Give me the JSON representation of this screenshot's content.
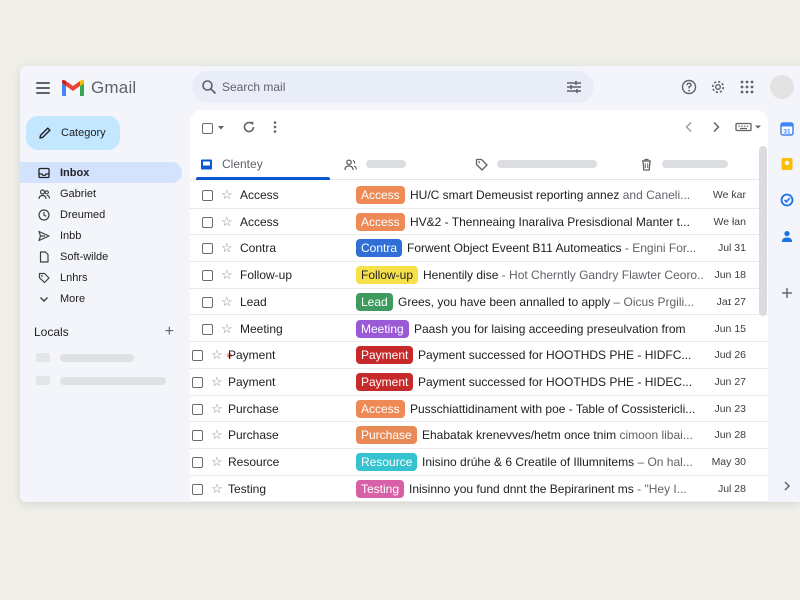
{
  "app": {
    "name": "Gmail"
  },
  "search": {
    "placeholder": "Search mail"
  },
  "compose": {
    "label": "Category"
  },
  "sidebar": {
    "items": [
      {
        "label": "Inbox",
        "icon": "inbox-icon",
        "active": true
      },
      {
        "label": "Gabriet",
        "icon": "people-icon"
      },
      {
        "label": "Dreumed",
        "icon": "clock-icon"
      },
      {
        "label": "Inbb",
        "icon": "send-icon"
      },
      {
        "label": "Soft-wilde",
        "icon": "file-icon"
      },
      {
        "label": "Lnhrs",
        "icon": "label-icon"
      },
      {
        "label": "More",
        "icon": "chevron-down-icon"
      }
    ],
    "locals_title": "Locals"
  },
  "tabs": [
    {
      "label": "Clentey",
      "icon": "inbox-icon",
      "active": true
    },
    {
      "label": "",
      "icon": "people-icon"
    },
    {
      "label": "",
      "icon": "tag-icon"
    },
    {
      "label": "",
      "icon": "trash-icon"
    }
  ],
  "colors": {
    "accent": "#0b57d0",
    "compose": "#c2e7ff",
    "active_nav": "#d3e3fd"
  },
  "emails": [
    {
      "sender": "Access",
      "label": "Access",
      "label_bg": "#ee8a55",
      "label_fg": "#ffffff",
      "subject": "HU/C smart Demeusist reporting annez",
      "snippet": " and Caneli...",
      "date": "We ƙar"
    },
    {
      "sender": "Access",
      "label": "Access",
      "label_bg": "#ee8a55",
      "label_fg": "#ffffff",
      "subject": "HV&2 - Thenneaing Inaraliva Presisdional Manter t...",
      "snippet": "",
      "date": "We ƚan"
    },
    {
      "sender": "Contra",
      "label": "Contra",
      "label_bg": "#2f6fd6",
      "label_fg": "#ffffff",
      "subject": "Forwent Object Eveent B11 Automeatics",
      "snippet": " - Engini For...",
      "date": "Jul 31"
    },
    {
      "sender": "Follow-up",
      "label": "Follow-up",
      "label_bg": "#f6e14a",
      "label_fg": "#202124",
      "subject": "Henentily dise",
      "snippet": " - Hot Cherntly Gandry Flawter Ceoro...",
      "date": "Jun 18"
    },
    {
      "sender": "Lead",
      "label": "Lead",
      "label_bg": "#3f9a5f",
      "label_fg": "#ffffff",
      "subject": "Grees, you have been annalled to apply",
      "snippet": " – Oicus Prgili...",
      "date": "Jaɪ 27"
    },
    {
      "sender": "Meeting",
      "label": "Meeting",
      "label_bg": "#9a5ad8",
      "label_fg": "#ffffff",
      "subject": "Paash you for laising acceeding preseulvation from",
      "snippet": "",
      "date": "Jun 15"
    },
    {
      "sender": "Payment",
      "label": "Payment",
      "label_bg": "#c62a2a",
      "label_fg": "#ffffff",
      "subject": "Payment successed for HOOTHDS PHE - HIDFC...",
      "snippet": "",
      "date": "Jud 26",
      "dot": true
    },
    {
      "sender": "Payment",
      "label": "Payment",
      "label_bg": "#c62a2a",
      "label_fg": "#ffffff",
      "subject": "Payment successed for HOOTHDS PHE - HIDEC...",
      "snippet": "",
      "date": "Jun 27"
    },
    {
      "sender": "Purchase",
      "label": "Access",
      "label_bg": "#ee8a55",
      "label_fg": "#ffffff",
      "subject": "Pusschiattidinament with poe - Table of Cossistericli...",
      "snippet": "",
      "date": "Jun 23"
    },
    {
      "sender": "Purchase",
      "label": "Purchase",
      "label_bg": "#e88a55",
      "label_fg": "#ffffff",
      "subject": "Ehabatak krenevves/hetm once tnim",
      "snippet": " cimoon libai...",
      "date": "Jun 28"
    },
    {
      "sender": "Resource",
      "label": "Resource",
      "label_bg": "#35c3cf",
      "label_fg": "#ffffff",
      "subject": "Inisino drúhe & 6 Creatile of Illumnitems",
      "snippet": " – On hal...",
      "date": "May 30"
    },
    {
      "sender": "Testing",
      "label": "Testing",
      "label_bg": "#d860a6",
      "label_fg": "#ffffff",
      "subject": "Inisinno you fund dnnt the Bepirarinent ms",
      "snippet": " - \"Hey I...",
      "date": "Jul 28"
    }
  ]
}
